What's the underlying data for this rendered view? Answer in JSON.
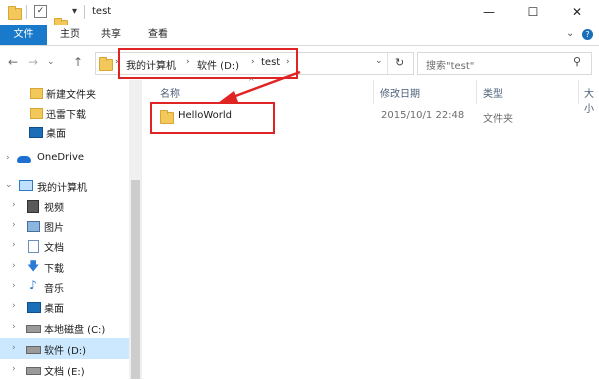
{
  "window": {
    "title": "test",
    "minimize_glyph": "—",
    "maximize_glyph": "☐",
    "close_glyph": "✕",
    "quick_access_glyph": "▾"
  },
  "ribbon": {
    "tabs": [
      "文件",
      "主页",
      "共享",
      "查看"
    ],
    "expand_glyph": "⌄",
    "help_glyph": "?"
  },
  "nav": {
    "back_glyph": "←",
    "forward_glyph": "→",
    "history_glyph": "⌄",
    "up_glyph": "↑",
    "breadcrumbs": [
      "我的计算机",
      "软件 (D:)",
      "test"
    ],
    "crumb_separator": "›",
    "address_dropdown_glyph": "⌄",
    "refresh_glyph": "↻",
    "search_placeholder": "搜索\"test\"",
    "search_glyph": "⚲"
  },
  "sidebar": {
    "items": [
      {
        "label": "新建文件夹",
        "icon": "folder-icon"
      },
      {
        "label": "迅雷下载",
        "icon": "folder-icon"
      },
      {
        "label": "桌面",
        "icon": "desktop-icon"
      },
      {
        "label": "OneDrive",
        "icon": "onedrive-icon"
      },
      {
        "label": "我的计算机",
        "icon": "computer-icon"
      },
      {
        "label": "视频",
        "icon": "video-icon"
      },
      {
        "label": "图片",
        "icon": "pictures-icon"
      },
      {
        "label": "文档",
        "icon": "documents-icon"
      },
      {
        "label": "下载",
        "icon": "download-icon"
      },
      {
        "label": "音乐",
        "icon": "music-icon"
      },
      {
        "label": "桌面",
        "icon": "desktop-icon"
      },
      {
        "label": "本地磁盘 (C:)",
        "icon": "drive-icon"
      },
      {
        "label": "软件 (D:)",
        "icon": "drive-icon",
        "selected": true
      },
      {
        "label": "文档 (E:)",
        "icon": "drive-icon"
      }
    ],
    "expander_collapsed_glyph": "›",
    "expander_expanded_glyph": "⌄"
  },
  "columns": {
    "name": "名称",
    "modified": "修改日期",
    "type": "类型",
    "size": "大小",
    "sort_glyph": "^"
  },
  "files": [
    {
      "name": "HelloWorld",
      "modified": "2015/10/1 22:48",
      "type": "文件夹",
      "icon": "folder-icon"
    }
  ],
  "colors": {
    "accent": "#1979ca",
    "annotation": "#e02424",
    "selection": "#cce8ff"
  }
}
